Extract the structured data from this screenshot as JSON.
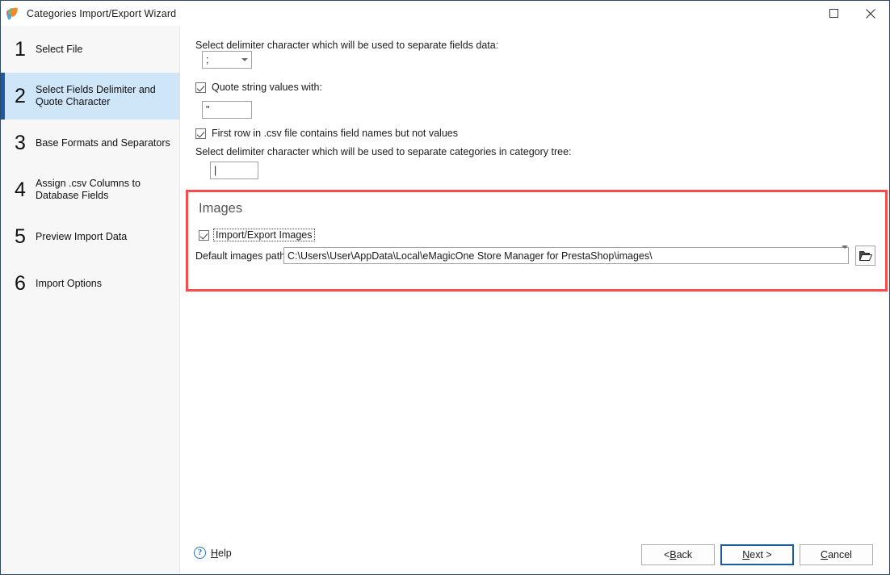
{
  "window": {
    "title": "Categories Import/Export Wizard",
    "icon": "emagicone-butterfly-icon",
    "maximize_label": "Maximize",
    "close_label": "Close"
  },
  "sidebar": {
    "steps": [
      {
        "num": "1",
        "label": "Select File",
        "selected": false
      },
      {
        "num": "2",
        "label": "Select Fields Delimiter and Quote Character",
        "selected": true
      },
      {
        "num": "3",
        "label": "Base Formats and Separators",
        "selected": false
      },
      {
        "num": "4",
        "label": "Assign .csv Columns to Database Fields",
        "selected": false
      },
      {
        "num": "5",
        "label": "Preview Import Data",
        "selected": false
      },
      {
        "num": "6",
        "label": "Import Options",
        "selected": false
      }
    ]
  },
  "main": {
    "fields_delimiter_label": "Select delimiter character which will be used to separate fields data:",
    "fields_delimiter_value": ";",
    "quote_checkbox_label": "Quote string values with:",
    "quote_checkbox_checked": true,
    "quote_value": "\"",
    "first_row_checkbox_label": "First row in .csv file contains field names but not values",
    "first_row_checkbox_checked": true,
    "tree_delimiter_label": "Select delimiter character which will be used to separate categories in category tree:",
    "tree_delimiter_value": "|",
    "images": {
      "group_title": "Images",
      "import_export_checkbox_label": "Import/Export Images",
      "import_export_checked": true,
      "path_label": "Default images path",
      "path_value": "C:\\Users\\User\\AppData\\Local\\eMagicOne Store Manager for PrestaShop\\images\\",
      "browse_icon": "folder-open-icon",
      "highlight_color": "#fa4b4b"
    }
  },
  "footer": {
    "help_icon": "question-circle-icon",
    "help_label": "Help",
    "help_mnemonic": "H",
    "buttons": [
      {
        "name": "back",
        "label": "< Back",
        "mnemonic": "B",
        "default": false
      },
      {
        "name": "next",
        "label": "Next >",
        "mnemonic": "N",
        "default": true
      },
      {
        "name": "cancel",
        "label": "Cancel",
        "mnemonic": "C",
        "default": false
      }
    ]
  },
  "colors": {
    "accent": "#1a5c9e",
    "selected_bg": "#cfe6f9",
    "sidebar_bg": "#f7f7f7",
    "highlight": "#fa4b4b"
  }
}
